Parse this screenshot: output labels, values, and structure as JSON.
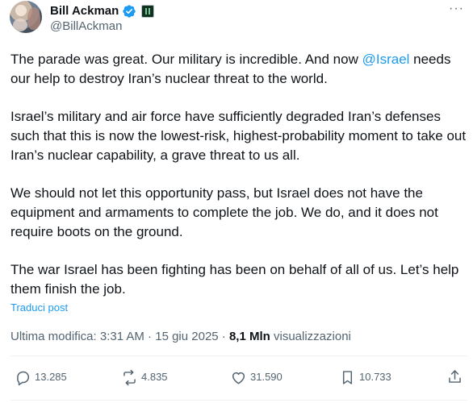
{
  "author": {
    "display_name": "Bill Ackman",
    "handle": "@BillAckman",
    "verified_icon": "verified-badge-icon",
    "affiliation_icon": "affiliation-badge-icon"
  },
  "more_label": "···",
  "tweet": {
    "p1_text": "The parade was great. Our military is incredible. And now ",
    "p1_mention": "@Israel",
    "p1_rest": " needs our help to destroy Iran’s nuclear threat to the world.",
    "p2": "Israel’s military and air force have sufficiently degraded Iran’s defenses such that this is now the lowest-risk, highest-probability moment to take out Iran’s nuclear capability, a grave threat to us all.",
    "p3": "We should not let this opportunity pass, but Israel does not have the equipment and armaments to complete the job. We do, and it does not require boots on the ground.",
    "p4": "The war Israel has been fighting has been on behalf of all of us. Let’s help them finish the job."
  },
  "translate_label": "Traduci post",
  "meta": {
    "edited_label": "Ultima modifica: 3:31 AM · 15 giu 2025 · ",
    "views_count": "8,1 Mln",
    "views_label": " visualizzazioni"
  },
  "actions": {
    "replies": "13.285",
    "reposts": "4.835",
    "likes": "31.590",
    "bookmarks": "10.733"
  },
  "colors": {
    "link": "#1d9bf0",
    "secondary_text": "#536471",
    "primary_text": "#0f1419"
  }
}
